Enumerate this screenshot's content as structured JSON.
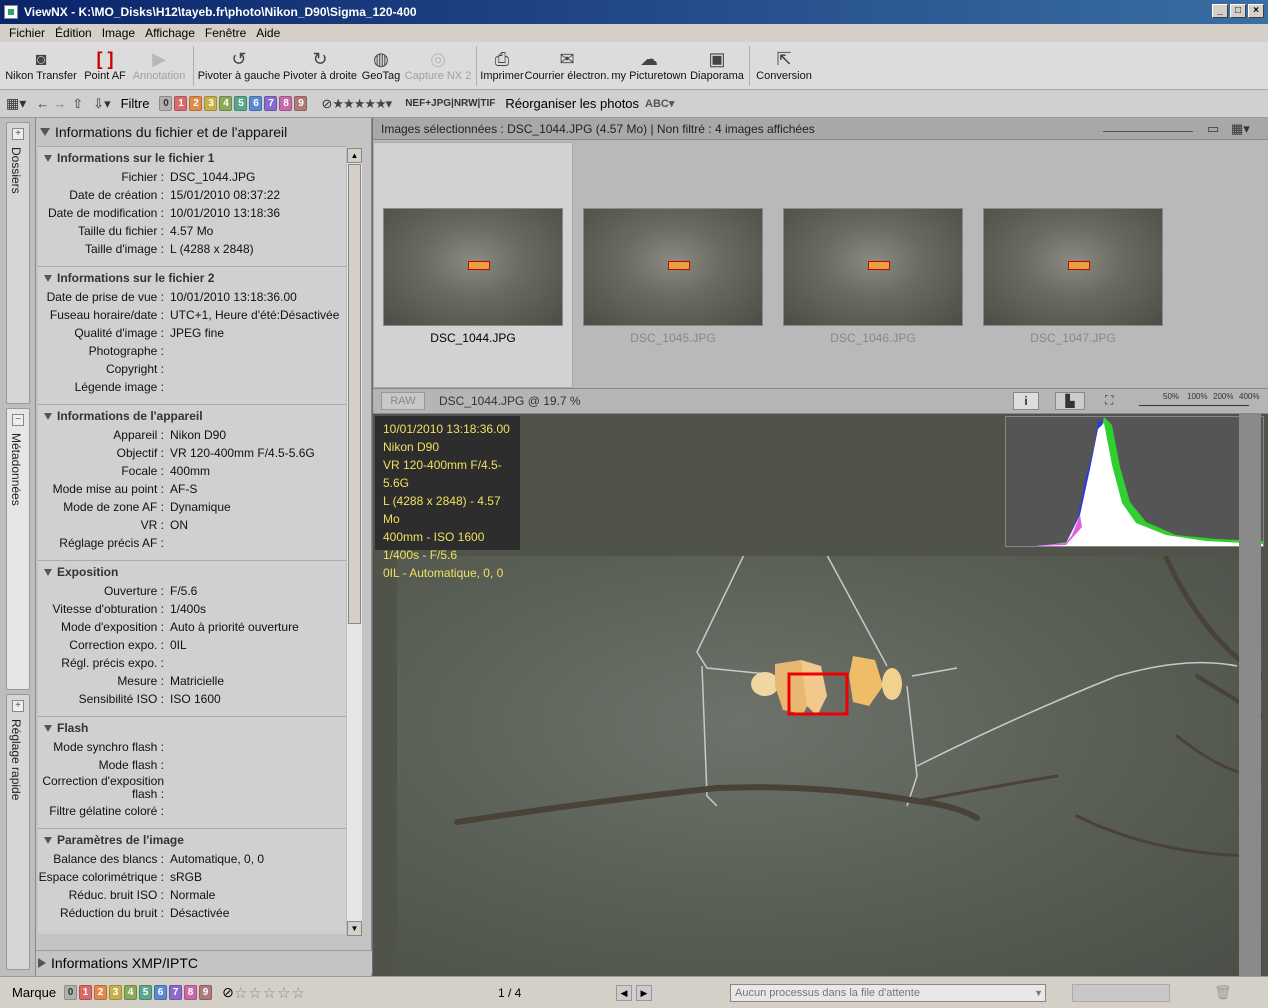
{
  "window": {
    "title": "ViewNX - K:\\MO_Disks\\H12\\tayeb.fr\\photo\\Nikon_D90\\Sigma_120-400"
  },
  "menu": [
    "Fichier",
    "Édition",
    "Image",
    "Affichage",
    "Fenêtre",
    "Aide"
  ],
  "toolbar": [
    {
      "label": "Nikon Transfer",
      "icon": "camera-icon",
      "enabled": true
    },
    {
      "label": "Point AF",
      "icon": "af-point-icon",
      "enabled": true
    },
    {
      "label": "Annotation",
      "icon": "annotation-icon",
      "enabled": false
    },
    {
      "label": "Pivoter à gauche",
      "icon": "rotate-left-icon",
      "enabled": true
    },
    {
      "label": "Pivoter à droite",
      "icon": "rotate-right-icon",
      "enabled": true
    },
    {
      "label": "GeoTag",
      "icon": "globe-icon",
      "enabled": true
    },
    {
      "label": "Capture NX 2",
      "icon": "capture-nx-icon",
      "enabled": false
    },
    {
      "label": "Imprimer",
      "icon": "print-icon",
      "enabled": true
    },
    {
      "label": "Courrier électron.",
      "icon": "mail-icon",
      "enabled": true
    },
    {
      "label": "my Picturetown",
      "icon": "picturetown-icon",
      "enabled": true
    },
    {
      "label": "Diaporama",
      "icon": "slideshow-icon",
      "enabled": true
    },
    {
      "label": "Conversion",
      "icon": "convert-icon",
      "enabled": true
    }
  ],
  "filterbar": {
    "filter_label": "Filtre",
    "labels": [
      "0",
      "1",
      "2",
      "3",
      "4",
      "5",
      "6",
      "7",
      "8",
      "9"
    ],
    "label_colors": [
      "#b0b0b0",
      "#d86a6a",
      "#e08a4a",
      "#c8b048",
      "#8aaa5a",
      "#5aa88a",
      "#5a8ad0",
      "#8a6ad0",
      "#c86aa8",
      "#b07a7a"
    ],
    "file_types": "NEF+JPG|NRW|TIF",
    "reorganize": "Réorganiser les photos"
  },
  "sidetabs": [
    "Dossiers",
    "Métadonnées",
    "Réglage rapide"
  ],
  "meta": {
    "header": "Informations du fichier et de l'appareil",
    "sections": [
      {
        "title": "Informations sur le fichier 1",
        "rows": [
          [
            "Fichier :",
            "DSC_1044.JPG"
          ],
          [
            "Date de création :",
            "15/01/2010 08:37:22"
          ],
          [
            "Date de modification :",
            "10/01/2010 13:18:36"
          ],
          [
            "Taille du fichier :",
            "4.57 Mo"
          ],
          [
            "Taille d'image :",
            "L (4288 x 2848)"
          ]
        ]
      },
      {
        "title": "Informations sur le fichier 2",
        "rows": [
          [
            "Date de prise de vue :",
            "10/01/2010 13:18:36.00"
          ],
          [
            "Fuseau horaire/date :",
            "UTC+1, Heure d'été:Désactivée"
          ],
          [
            "Qualité d'image :",
            "JPEG fine"
          ],
          [
            "Photographe :",
            ""
          ],
          [
            "Copyright :",
            ""
          ],
          [
            "Légende image :",
            ""
          ]
        ]
      },
      {
        "title": "Informations de l'appareil",
        "rows": [
          [
            "Appareil :",
            "Nikon D90"
          ],
          [
            "Objectif :",
            "VR 120-400mm F/4.5-5.6G"
          ],
          [
            "Focale :",
            "400mm"
          ],
          [
            "Mode mise au point :",
            "AF-S"
          ],
          [
            "Mode de zone AF :",
            "Dynamique"
          ],
          [
            "VR :",
            "ON"
          ],
          [
            "Réglage précis AF :",
            ""
          ]
        ]
      },
      {
        "title": "Exposition",
        "rows": [
          [
            "Ouverture :",
            "F/5.6"
          ],
          [
            "Vitesse d'obturation :",
            "1/400s"
          ],
          [
            "Mode d'exposition :",
            "Auto à priorité ouverture"
          ],
          [
            "Correction expo. :",
            "0IL"
          ],
          [
            "Régl. précis expo. :",
            ""
          ],
          [
            "Mesure :",
            "Matricielle"
          ],
          [
            "Sensibilité ISO :",
            "ISO 1600"
          ]
        ]
      },
      {
        "title": "Flash",
        "rows": [
          [
            "Mode synchro flash :",
            ""
          ],
          [
            "Mode flash :",
            ""
          ],
          [
            "Correction d'exposition flash :",
            ""
          ],
          [
            "Filtre gélatine coloré :",
            ""
          ]
        ]
      },
      {
        "title": "Paramètres de l'image",
        "rows": [
          [
            "Balance des blancs :",
            "Automatique, 0, 0"
          ],
          [
            "Espace colorimétrique :",
            "sRGB"
          ],
          [
            "Réduc. bruit ISO :",
            "Normale"
          ],
          [
            "Réduction du bruit :",
            "Désactivée"
          ]
        ]
      }
    ],
    "xmp": "Informations XMP/IPTC"
  },
  "browser": {
    "info": "Images sélectionnées : DSC_1044.JPG (4.57 Mo) | Non filtré : 4 images affichées",
    "thumbs": [
      "DSC_1044.JPG",
      "DSC_1045.JPG",
      "DSC_1046.JPG",
      "DSC_1047.JPG"
    ]
  },
  "viewer": {
    "raw": "RAW",
    "caption": "DSC_1044.JPG @ 19.7 %",
    "zoom_ticks": [
      "50%",
      "100%",
      "200%",
      "400%"
    ],
    "overlay": [
      "10/01/2010 13:18:36.00",
      "Nikon D90",
      "VR 120-400mm F/4.5-5.6G",
      "L (4288 x 2848) - 4.57 Mo",
      "400mm - ISO 1600",
      "1/400s - F/5.6",
      "0IL - Automatique, 0, 0"
    ]
  },
  "status": {
    "mark": "Marque",
    "page": "1 / 4",
    "queue": "Aucun processus dans la file d'attente"
  }
}
